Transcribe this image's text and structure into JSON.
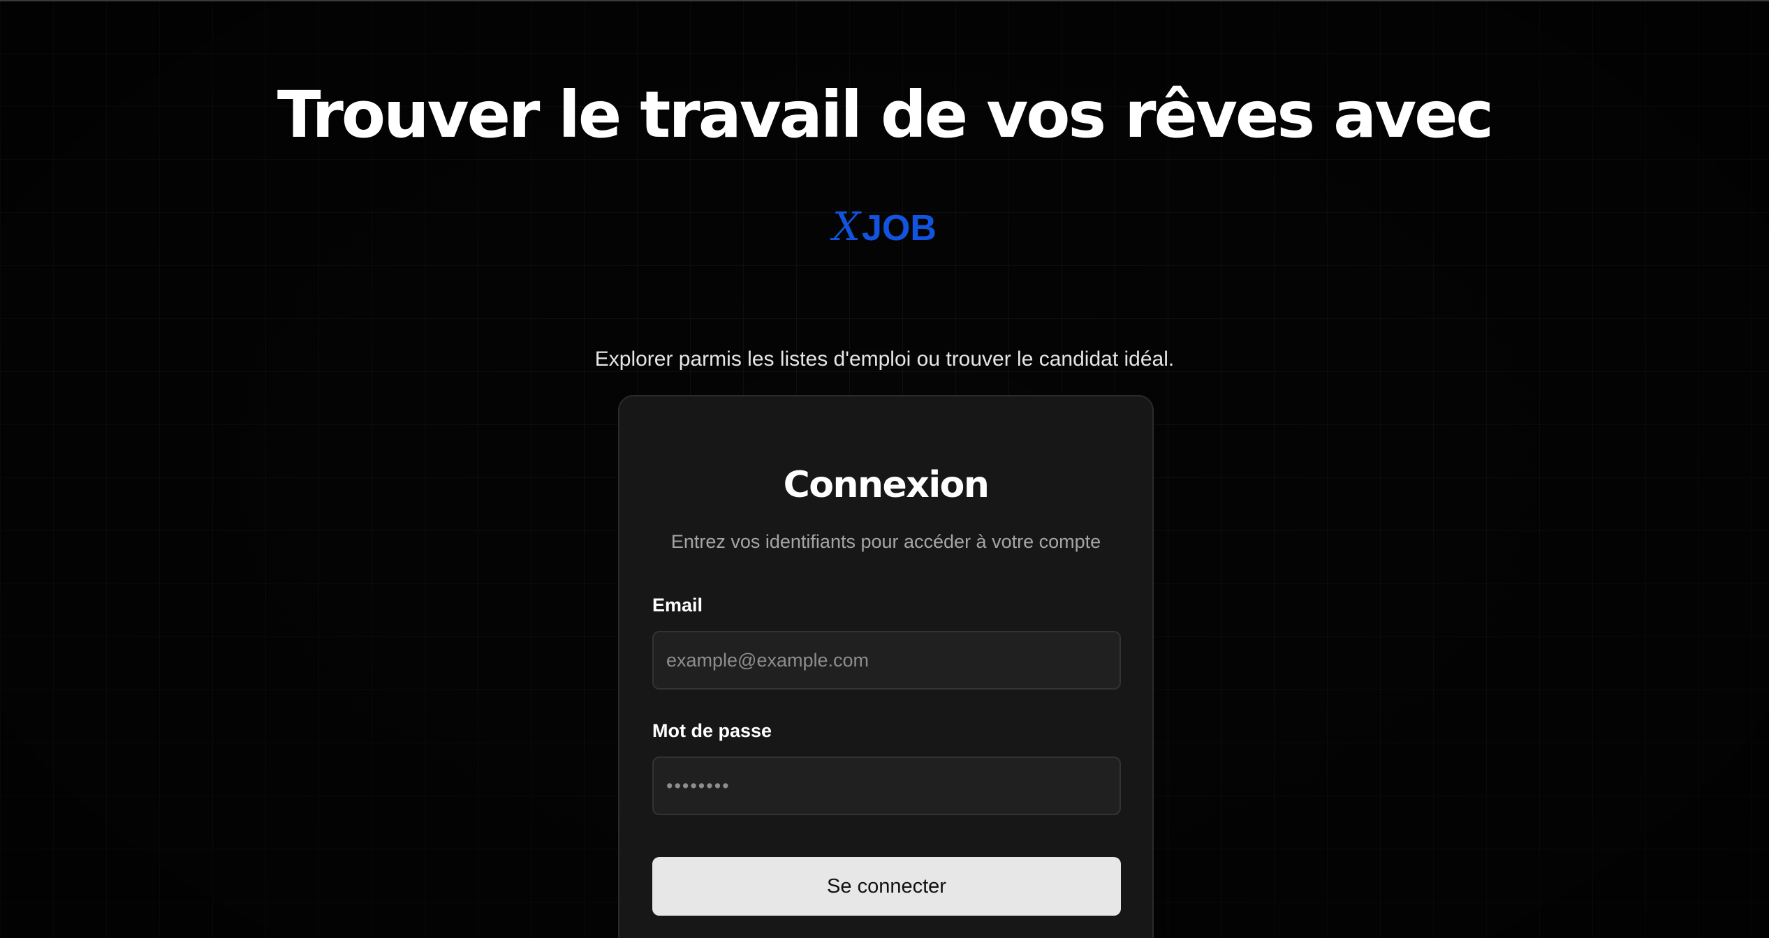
{
  "hero": {
    "title": "Trouver le travail de vos rêves avec",
    "brand_x": "X",
    "brand_job": "JOB",
    "subtitle": "Explorer parmis les listes d'emploi ou trouver le candidat idéal."
  },
  "login": {
    "title": "Connexion",
    "description": "Entrez vos identifiants pour accéder à votre compte",
    "email_label": "Email",
    "email_placeholder": "example@example.com",
    "password_label": "Mot de passe",
    "password_placeholder": "••••••••",
    "submit_label": "Se connecter"
  },
  "colors": {
    "background": "#000000",
    "brand": "#1254e0",
    "card": "#171717",
    "button": "#e7e7e7"
  }
}
